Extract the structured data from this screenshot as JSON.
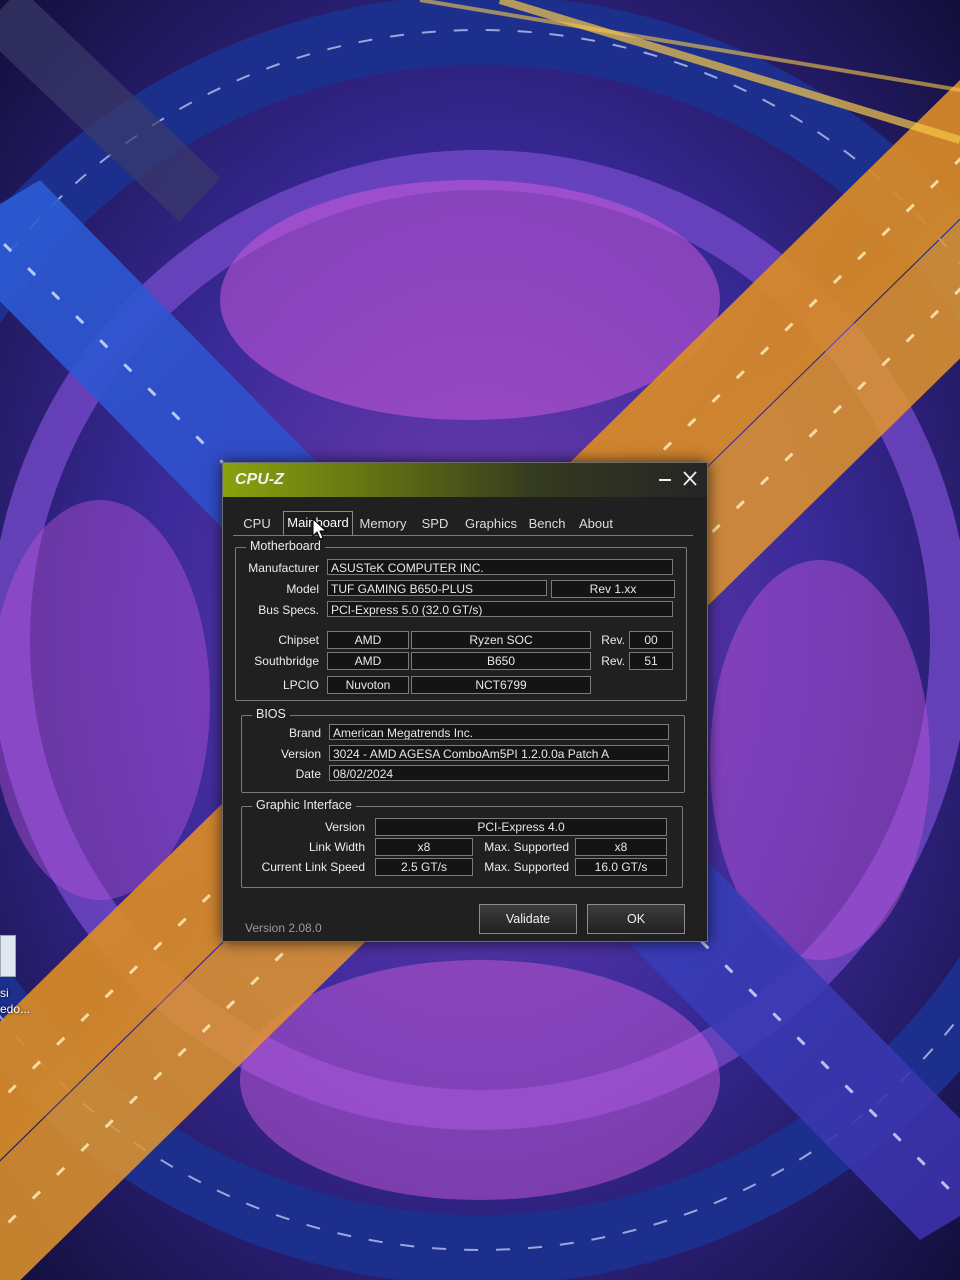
{
  "desktop": {
    "icon_label": "si\nedo..."
  },
  "window": {
    "title": "CPU-Z",
    "tabs": [
      "CPU",
      "Mainboard",
      "Memory",
      "SPD",
      "Graphics",
      "Bench",
      "About"
    ],
    "active_tab": "Mainboard",
    "close_symbol": "✕",
    "minimize_symbol": "—"
  },
  "motherboard": {
    "title": "Motherboard",
    "manufacturer_label": "Manufacturer",
    "manufacturer": "ASUSTeK COMPUTER INC.",
    "model_label": "Model",
    "model": "TUF GAMING B650-PLUS",
    "model_rev": "Rev 1.xx",
    "bus_label": "Bus Specs.",
    "bus": "PCI-Express 5.0 (32.0 GT/s)",
    "chipset_label": "Chipset",
    "chipset_vendor": "AMD",
    "chipset_name": "Ryzen SOC",
    "rev_label": "Rev.",
    "chipset_rev": "00",
    "southbridge_label": "Southbridge",
    "southbridge_vendor": "AMD",
    "southbridge_name": "B650",
    "southbridge_rev": "51",
    "lpcio_label": "LPCIO",
    "lpcio_vendor": "Nuvoton",
    "lpcio_name": "NCT6799"
  },
  "bios": {
    "title": "BIOS",
    "brand_label": "Brand",
    "brand": "American Megatrends Inc.",
    "version_label": "Version",
    "version": "3024 - AMD AGESA ComboAm5PI 1.2.0.0a Patch A",
    "date_label": "Date",
    "date": "08/02/2024"
  },
  "graphic": {
    "title": "Graphic Interface",
    "version_label": "Version",
    "version": "PCI-Express 4.0",
    "link_width_label": "Link Width",
    "link_width": "x8",
    "max_supported_label": "Max. Supported",
    "link_width_max": "x8",
    "link_speed_label": "Current Link Speed",
    "link_speed": "2.5 GT/s",
    "link_speed_max": "16.0 GT/s"
  },
  "footer": {
    "version": "Version 2.08.0",
    "validate_label": "Validate",
    "ok_label": "OK"
  },
  "colors": {
    "window_bg": "#202020",
    "title_accent": "#8aa10f",
    "field_bg": "#141414"
  }
}
